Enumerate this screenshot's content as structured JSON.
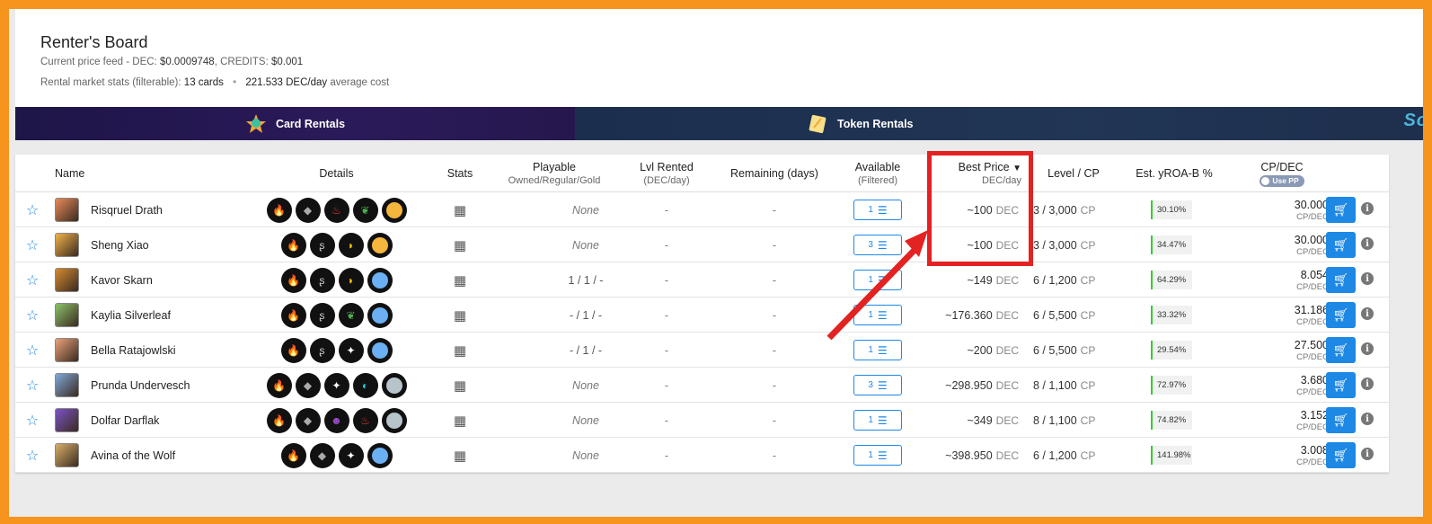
{
  "header": {
    "title": "Renter's Board",
    "price_prefix": "Current price feed - DEC: ",
    "dec_price": "$0.0009748",
    "credits_prefix": ", CREDITS: ",
    "credits_price": "$0.001",
    "stats_prefix": "Rental market stats (filterable):",
    "cards_count": "13 cards",
    "avg_value": "221.533 DEC/day",
    "avg_suffix": "average cost"
  },
  "tabs": {
    "card_rentals": "Card Rentals",
    "token_rentals": "Token Rentals"
  },
  "columns": {
    "name": "Name",
    "details": "Details",
    "stats": "Stats",
    "playable": "Playable",
    "playable_sub": "Owned/Regular/Gold",
    "lvl_rented": "Lvl Rented",
    "lvl_rented_sub": "(DEC/day)",
    "remaining": "Remaining (days)",
    "available": "Available",
    "available_sub": "(Filtered)",
    "best_price": "Best Price",
    "best_price_sub": "DEC/day",
    "level_cp": "Level / CP",
    "yroa": "Est. yROA-B %",
    "cp_dec": "CP/DEC",
    "use_pp": "Use PP"
  },
  "units": {
    "dec": "DEC",
    "cp": "CP",
    "cpdec": "CP/DEC"
  },
  "rows": [
    {
      "name": "Risqruel Drath",
      "playable": "None",
      "lvl": "-",
      "remaining": "-",
      "available": "1",
      "price": "~100",
      "level_cp": "3 / 3,000",
      "yroa": "30.10%",
      "cpdec": "30.000"
    },
    {
      "name": "Sheng Xiao",
      "playable": "None",
      "lvl": "-",
      "remaining": "-",
      "available": "3",
      "price": "~100",
      "level_cp": "3 / 3,000",
      "yroa": "34.47%",
      "cpdec": "30.000"
    },
    {
      "name": "Kavor Skarn",
      "playable": "1 / 1 / -",
      "lvl": "-",
      "remaining": "-",
      "available": "1",
      "price": "~149",
      "level_cp": "6 / 1,200",
      "yroa": "64.29%",
      "cpdec": "8.054"
    },
    {
      "name": "Kaylia Silverleaf",
      "playable": "- / 1 / -",
      "lvl": "-",
      "remaining": "-",
      "available": "1",
      "price": "~176.360",
      "level_cp": "6 / 5,500",
      "yroa": "33.32%",
      "cpdec": "31.186"
    },
    {
      "name": "Bella Ratajowlski",
      "playable": "- / 1 / -",
      "lvl": "-",
      "remaining": "-",
      "available": "1",
      "price": "~200",
      "level_cp": "6 / 5,500",
      "yroa": "29.54%",
      "cpdec": "27.500"
    },
    {
      "name": "Prunda Undervesch",
      "playable": "None",
      "lvl": "-",
      "remaining": "-",
      "available": "3",
      "price": "~298.950",
      "level_cp": "8 / 1,100",
      "yroa": "72.97%",
      "cpdec": "3.680"
    },
    {
      "name": "Dolfar Darflak",
      "playable": "None",
      "lvl": "-",
      "remaining": "-",
      "available": "1",
      "price": "~349",
      "level_cp": "8 / 1,100",
      "yroa": "74.82%",
      "cpdec": "3.152"
    },
    {
      "name": "Avina of the Wolf",
      "playable": "None",
      "lvl": "-",
      "remaining": "-",
      "available": "1",
      "price": "~398.950",
      "level_cp": "6 / 1,200",
      "yroa": "141.98%",
      "cpdec": "3.008"
    }
  ]
}
